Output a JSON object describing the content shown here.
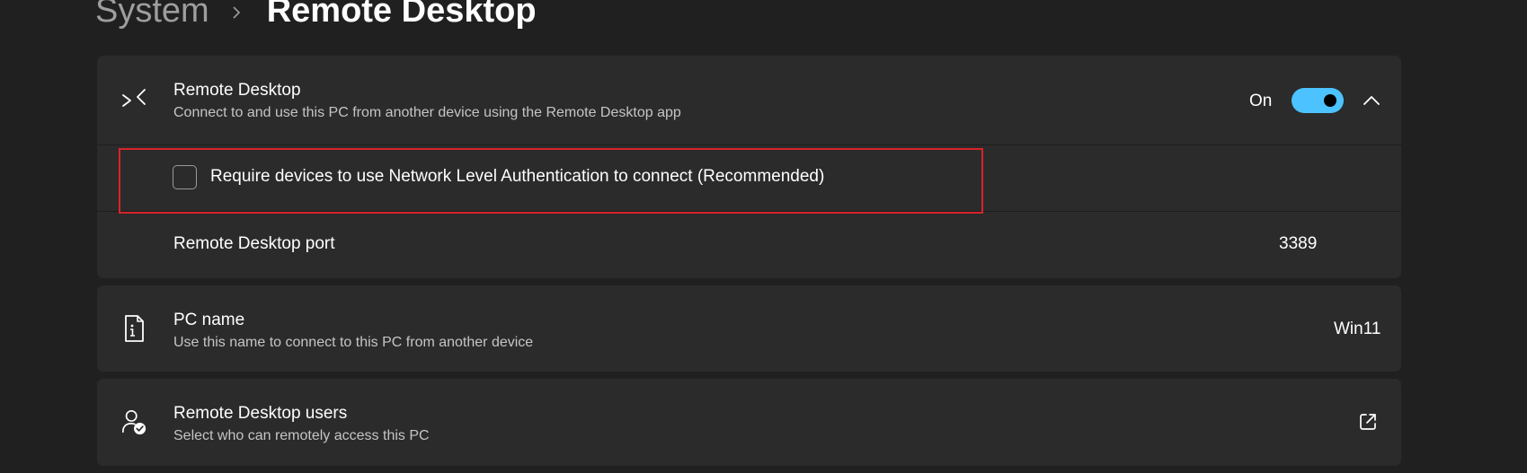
{
  "breadcrumb": {
    "parent": "System",
    "current": "Remote Desktop"
  },
  "remote_desktop": {
    "icon": "remote-desktop-icon",
    "title": "Remote Desktop",
    "subtitle": "Connect to and use this PC from another device using the Remote Desktop app",
    "toggle_state_label": "On",
    "toggle_on": true,
    "nla_checkbox_label": "Require devices to use Network Level Authentication to connect (Recommended)",
    "nla_checked": false,
    "port_label": "Remote Desktop port",
    "port_value": "3389"
  },
  "pc_name": {
    "icon": "pc-name-icon",
    "title": "PC name",
    "subtitle": "Use this name to connect to this PC from another device",
    "value": "Win11"
  },
  "users": {
    "icon": "user-check-icon",
    "title": "Remote Desktop users",
    "subtitle": "Select who can remotely access this PC",
    "action_icon": "open-external-icon"
  },
  "colors": {
    "background": "#202020",
    "card": "#2b2b2b",
    "accent": "#4cc2ff",
    "highlight_border": "#d9232a"
  }
}
